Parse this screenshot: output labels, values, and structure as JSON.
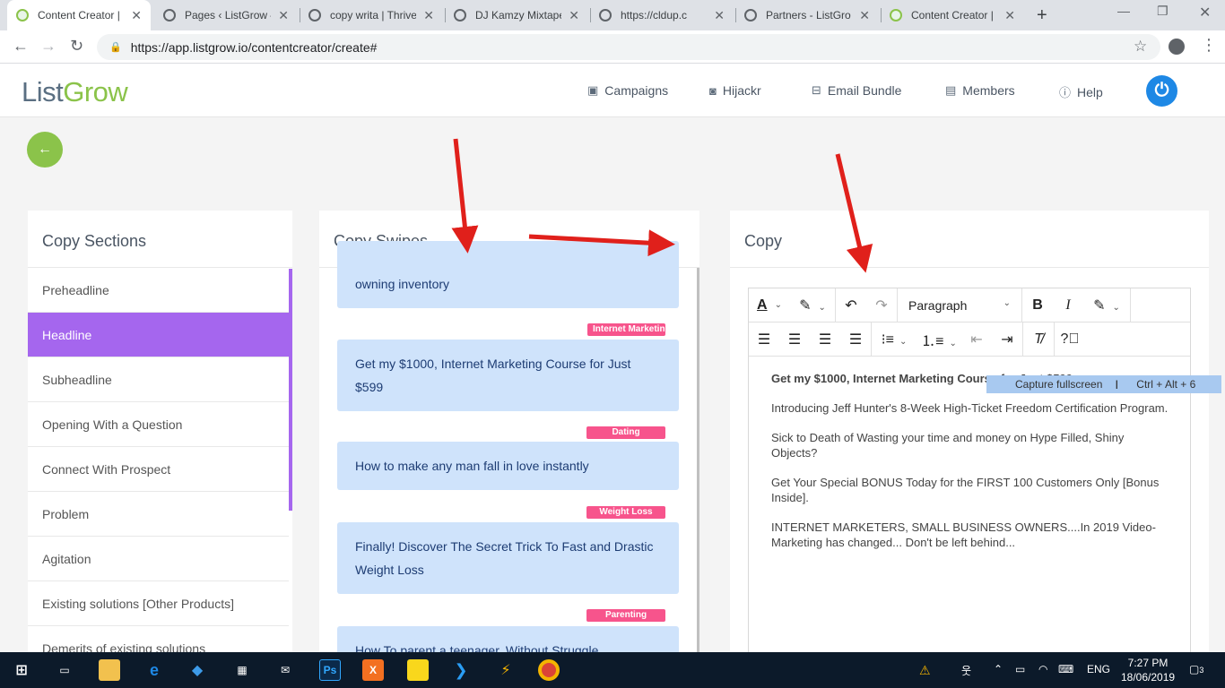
{
  "browser": {
    "tabs": [
      {
        "title": "Content Creator | L",
        "active": true
      },
      {
        "title": "Pages ‹ ListGrow —"
      },
      {
        "title": "copy writa | Thrive"
      },
      {
        "title": "DJ Kamzy Mixtape"
      },
      {
        "title": "https://cldup.c"
      },
      {
        "title": "Partners - ListGro"
      },
      {
        "title": "Content Creator | L"
      }
    ],
    "url": "https://app.listgrow.io/contentcreator/create#"
  },
  "header": {
    "logo_part1": "List",
    "logo_part2": "Grow",
    "nav": [
      {
        "label": "Campaigns",
        "icon": "campaigns-icon"
      },
      {
        "label": "Hijackr",
        "icon": "camera-icon"
      },
      {
        "label": "Email Bundle",
        "icon": "inbox-icon"
      },
      {
        "label": "Members",
        "icon": "members-icon"
      },
      {
        "label": "Help",
        "icon": "info-icon"
      }
    ]
  },
  "sections": {
    "title": "Copy Sections",
    "items": [
      "Preheadline",
      "Headline",
      "Subheadline",
      "Opening With a Question",
      "Connect With Prospect",
      "Problem",
      "Agitation",
      "Existing solutions [Other Products]",
      "Demerits of existing solutions"
    ],
    "active": "Headline"
  },
  "swipes": {
    "title": "Copy Swipes",
    "cards": [
      {
        "text": "owning inventory",
        "tag": ""
      },
      {
        "text": "Get my $1000, Internet Marketing Course for Just $599",
        "tag": "Internet Marketing"
      },
      {
        "text": "How to make any man fall in love instantly",
        "tag": "Dating"
      },
      {
        "text": "Finally! Discover The Secret Trick To Fast and Drastic Weight Loss",
        "tag": "Weight Loss"
      },
      {
        "text": "How To parent a teenager, Without Struggle",
        "tag": "Parenting"
      }
    ]
  },
  "copy": {
    "title": "Copy",
    "format": "Paragraph",
    "paragraphs": [
      "Get my $1000, Internet Marketing Course for Just $599",
      "Introducing Jeff Hunter's 8-Week High-Ticket Freedom Certification Program.",
      "Sick to Death of Wasting your time and money on Hype Filled, Shiny Objects?",
      "Get Your Special BONUS Today for the FIRST 100 Customers Only [Bonus Inside].",
      "INTERNET MARKETERS, SMALL BUSINESS OWNERS....In 2019 Video-Marketing has changed... Don't be left behind..."
    ]
  },
  "tooltip": {
    "label": "Capture fullscreen",
    "shortcut": "Ctrl + Alt + 6"
  },
  "taskbar": {
    "lang": "ENG",
    "time": "7:27 PM",
    "date": "18/06/2019",
    "notif_count": "3"
  },
  "colors": {
    "accent_purple": "#a566ee",
    "brand_green": "#8bc34a",
    "tag_pink": "#f7548c",
    "card_blue": "#cfe3fb"
  }
}
